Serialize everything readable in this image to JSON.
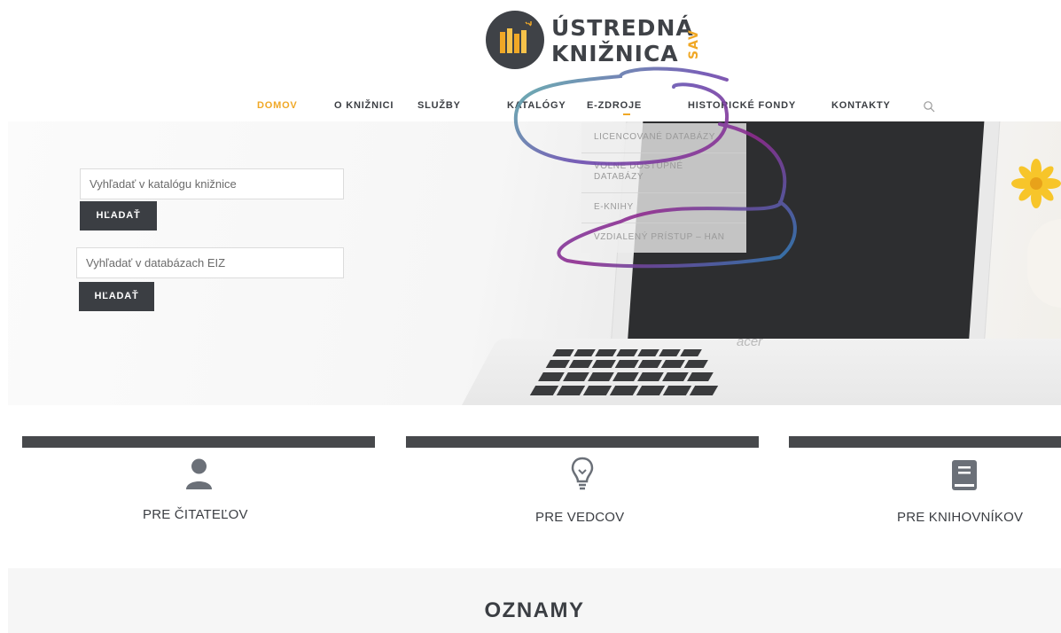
{
  "logo": {
    "line1": "ÚSTREDNÁ",
    "line2": "KNIŽNICA",
    "sav": "SAV",
    "colors": {
      "dark": "#3f4247",
      "accent": "#f0a826"
    }
  },
  "nav": {
    "items": [
      {
        "label": "DOMOV",
        "active": true
      },
      {
        "label": "O KNIŽNICI",
        "active": false
      },
      {
        "label": "SLUŽBY",
        "active": false
      },
      {
        "label": "KATALÓGY",
        "active": false
      },
      {
        "label": "E-ZDROJE",
        "active": false
      },
      {
        "label": "HISTORICKÉ FONDY",
        "active": false
      },
      {
        "label": "KONTAKTY",
        "active": false
      }
    ],
    "search_icon": "search-icon"
  },
  "dropdown": {
    "items": [
      "LICENCOVANÉ DATABÁZY",
      "VOĽNE DOSTUPNÉ",
      "DATABÁZY",
      "E-KNIHY",
      "VZDIALENÝ PRÍSTUP – HAN"
    ]
  },
  "hero": {
    "catalog_search": {
      "placeholder": "Vyhľadať v katalógu knižnice",
      "button": "HĽADAŤ"
    },
    "eiz_search": {
      "placeholder": "Vyhľadať v databázach EIZ",
      "button": "HĽADAŤ"
    },
    "laptop_brand": "acer"
  },
  "cards": [
    {
      "label": "PRE ČITATEĽOV",
      "icon": "user-icon"
    },
    {
      "label": "PRE VEDCOV",
      "icon": "lightbulb-icon"
    },
    {
      "label": "PRE KNIHOVNÍKOV",
      "icon": "book-icon"
    }
  ],
  "announcements": {
    "title": "OZNAMY"
  },
  "colors": {
    "accent": "#f0a826",
    "dark": "#3b3e43",
    "card_bar": "#47494c",
    "icon_gray": "#6b7078"
  }
}
